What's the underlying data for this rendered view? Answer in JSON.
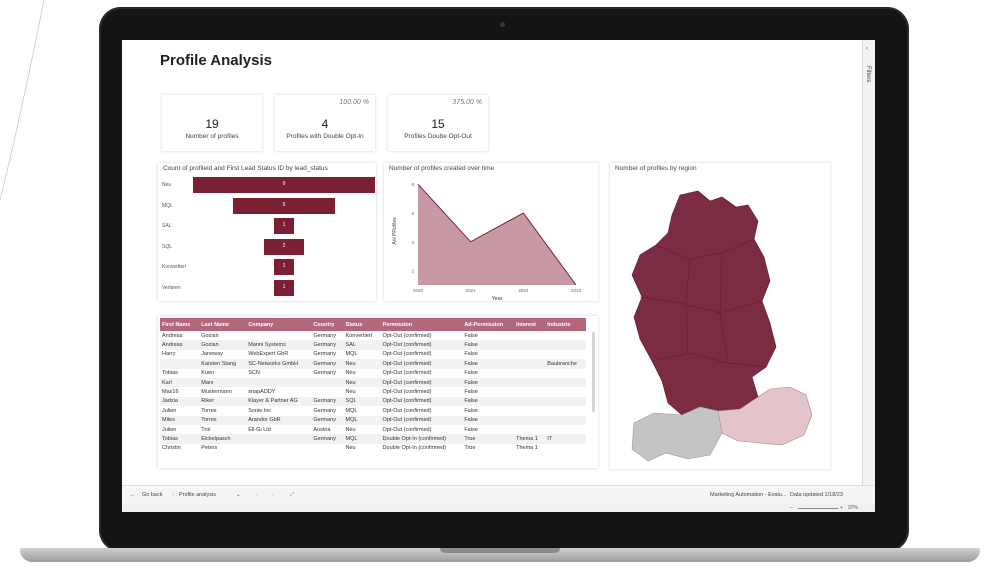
{
  "page": {
    "title": "Profile Analysis"
  },
  "filters_pane": {
    "label": "Filters"
  },
  "kpis": [
    {
      "value": "19",
      "label": "Number of profiles",
      "pct": ""
    },
    {
      "value": "4",
      "label": "Profiles with Double Opt-In",
      "pct": "100.00 %"
    },
    {
      "value": "15",
      "label": "Profiles Doube Opt-Out",
      "pct": "375.00 %"
    }
  ],
  "funnel": {
    "title": "Count of profileid and First Lead Status ID by lead_status",
    "color": "#7b1f35",
    "max": 9,
    "stages": [
      {
        "label": "Neu",
        "value": 9
      },
      {
        "label": "MQL",
        "value": 5
      },
      {
        "label": "SAL",
        "value": 1
      },
      {
        "label": "SQL",
        "value": 2
      },
      {
        "label": "Konvertiert",
        "value": 1
      },
      {
        "label": "Verloren",
        "value": 1
      }
    ]
  },
  "chart_data": {
    "type": "area",
    "title": "Number of profiles created over time",
    "xlabel": "Year",
    "ylabel": "Anl PRofiles",
    "x": [
      "2020",
      "2021",
      "2022",
      "2023"
    ],
    "y_ticks": [
      "2",
      "4",
      "6",
      "8"
    ],
    "ylim": [
      1,
      8.5
    ],
    "series": [
      {
        "values": [
          8,
          4,
          6,
          1
        ]
      }
    ],
    "line_color": "#7b1f35",
    "fill_color": "#c79aa3"
  },
  "map": {
    "title": "Number of profiles by region",
    "germany_color": "#7b2c40",
    "austria_color": "#e2c4ca",
    "switzerland_color": "#c4c4c4"
  },
  "table": {
    "columns": [
      "First Name",
      "Last Name",
      "Company",
      "Country",
      "Status",
      "Permission",
      "Ad-Permission",
      "Interest",
      "Industrie"
    ],
    "rows": [
      [
        "Andreas",
        "Gozian",
        "",
        "Germany",
        "Konvertiert",
        "Opt-Out (confirmed)",
        "False",
        "",
        ""
      ],
      [
        "Andreas",
        "Gozian",
        "Manni Systems",
        "Germany",
        "SAL",
        "Opt-Out (confirmed)",
        "False",
        "",
        ""
      ],
      [
        "Harry",
        "Janeway",
        "WebExpert GbR",
        "Germany",
        "MQL",
        "Opt-Out (confirmed)",
        "False",
        "",
        ""
      ],
      [
        "",
        "Karsten Stang",
        "SC-Networks GmbH",
        "Germany",
        "Neu",
        "Opt-Out (confirmed)",
        "False",
        "",
        "Baubranche"
      ],
      [
        "Tobias",
        "Kuen",
        "SCN",
        "Germany",
        "Neu",
        "Opt-Out (confirmed)",
        "False",
        "",
        ""
      ],
      [
        "Karl",
        "Marx",
        "",
        "",
        "Neu",
        "Opt-Out (confirmed)",
        "False",
        "",
        ""
      ],
      [
        "Max16",
        "Mustermann",
        "snapADDY",
        "",
        "Neu",
        "Opt-Out (confirmed)",
        "False",
        "",
        ""
      ],
      [
        "Jadzia",
        "Riker",
        "Klayer & Partner AG",
        "Germany",
        "SQL",
        "Opt-Out (confirmed)",
        "False",
        "",
        ""
      ],
      [
        "Julien",
        "Torres",
        "Sonie Inc",
        "Germany",
        "MQL",
        "Opt-Out (confirmed)",
        "False",
        "",
        ""
      ],
      [
        "Miles",
        "Torres",
        "Arandor GbR",
        "Germany",
        "MQL",
        "Opt-Out (confirmed)",
        "False",
        "",
        ""
      ],
      [
        "Julien",
        "Troi",
        "Ell-Gi Ltd",
        "Austria",
        "Neu",
        "Opt-Out (confirmed)",
        "False",
        "",
        ""
      ],
      [
        "Tobias",
        "Eickelpasch",
        "",
        "Germany",
        "MQL",
        "Double Opt-In (confirmed)",
        "True",
        "Thema 1",
        "IT"
      ],
      [
        "Christin",
        "Peters",
        "",
        "",
        "Neu",
        "Double Opt-In (confirmed)",
        "True",
        "Thema 1",
        ""
      ]
    ]
  },
  "footer": {
    "back_label": "Go back",
    "page_tab": "Profile analysis",
    "report_name": "Marketing Automation - Evalu...",
    "data_updated": "Data updated 1/18/23",
    "zoom": "37%"
  }
}
